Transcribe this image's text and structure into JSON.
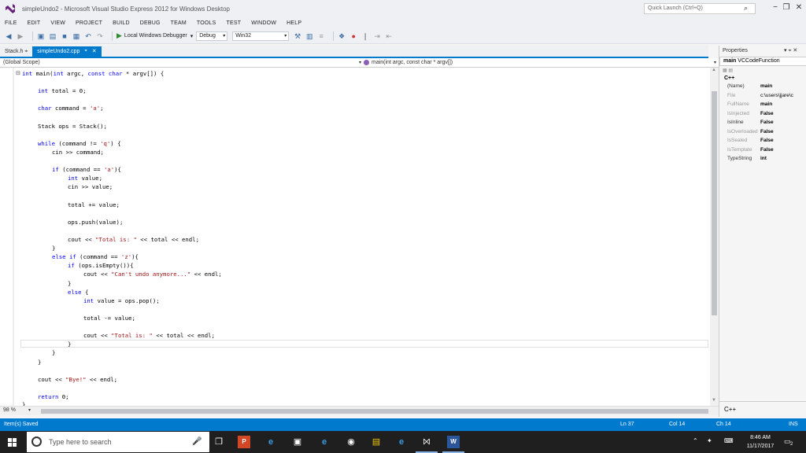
{
  "window": {
    "title": "simpleUndo2 - Microsoft Visual Studio Express 2012 for Windows Desktop",
    "quick_launch_placeholder": "Quick Launch (Ctrl+Q)"
  },
  "menu": [
    "FILE",
    "EDIT",
    "VIEW",
    "PROJECT",
    "BUILD",
    "DEBUG",
    "TEAM",
    "TOOLS",
    "TEST",
    "WINDOW",
    "HELP"
  ],
  "toolbar": {
    "debugger_label": "Local Windows Debugger",
    "config": "Debug",
    "platform": "Win32"
  },
  "tabs": {
    "stack_tab": "Stack.h",
    "active_tab": "simpleUndo2.cpp"
  },
  "nav": {
    "scope": "(Global Scope)",
    "function": "main(int argc, const char * argv[])"
  },
  "code": [
    "int main(int argc, const char * argv[]) {",
    "    int total = 0;",
    "    char command = 'a';",
    "    Stack ops = Stack();",
    "    while (command != 'q') {",
    "        cin >> command;",
    "        if (command == 'a'){",
    "            int value;",
    "            cin >> value;",
    "            total += value;",
    "            ops.push(value);",
    "            cout << \"Total is: \" << total << endl;",
    "        }",
    "        else if (command == 'z'){",
    "            if (ops.isEmpty()){",
    "                cout << \"Can't undo anymore...\" << endl;",
    "            }",
    "            else {",
    "                int value = ops.pop();",
    "                total -= value;",
    "                cout << \"Total is: \" << total << endl;",
    "            }",
    "        }",
    "    }",
    "    cout << \"Bye!\" << endl;",
    "    return 0;",
    "}"
  ],
  "zoom": "98 %",
  "properties": {
    "title": "Properties",
    "object_name": "main",
    "object_type": "VCCodeFunction",
    "category": "C++",
    "rows": [
      {
        "name": "(Name)",
        "value": "main",
        "dim": false
      },
      {
        "name": "File",
        "value": "c:\\users\\jjare\\c",
        "dim": true
      },
      {
        "name": "FullName",
        "value": "main",
        "dim": true
      },
      {
        "name": "IsInjected",
        "value": "False",
        "dim": true
      },
      {
        "name": "IsInline",
        "value": "False",
        "dim": false
      },
      {
        "name": "IsOverloaded",
        "value": "False",
        "dim": true
      },
      {
        "name": "IsSealed",
        "value": "False",
        "dim": true
      },
      {
        "name": "IsTemplate",
        "value": "False",
        "dim": true
      },
      {
        "name": "TypeString",
        "value": "int",
        "dim": false
      }
    ],
    "description": "C++"
  },
  "status": {
    "message": "Item(s) Saved",
    "ln": "Ln 37",
    "col": "Col 14",
    "ch": "Ch 14",
    "mode": "INS"
  },
  "taskbar": {
    "search_placeholder": "Type here to search",
    "time": "8:46 AM",
    "date": "11/17/2017",
    "notification_count": "2"
  },
  "colors": {
    "accent": "#007acc",
    "keyword": "#0000ff",
    "string": "#a31515"
  }
}
